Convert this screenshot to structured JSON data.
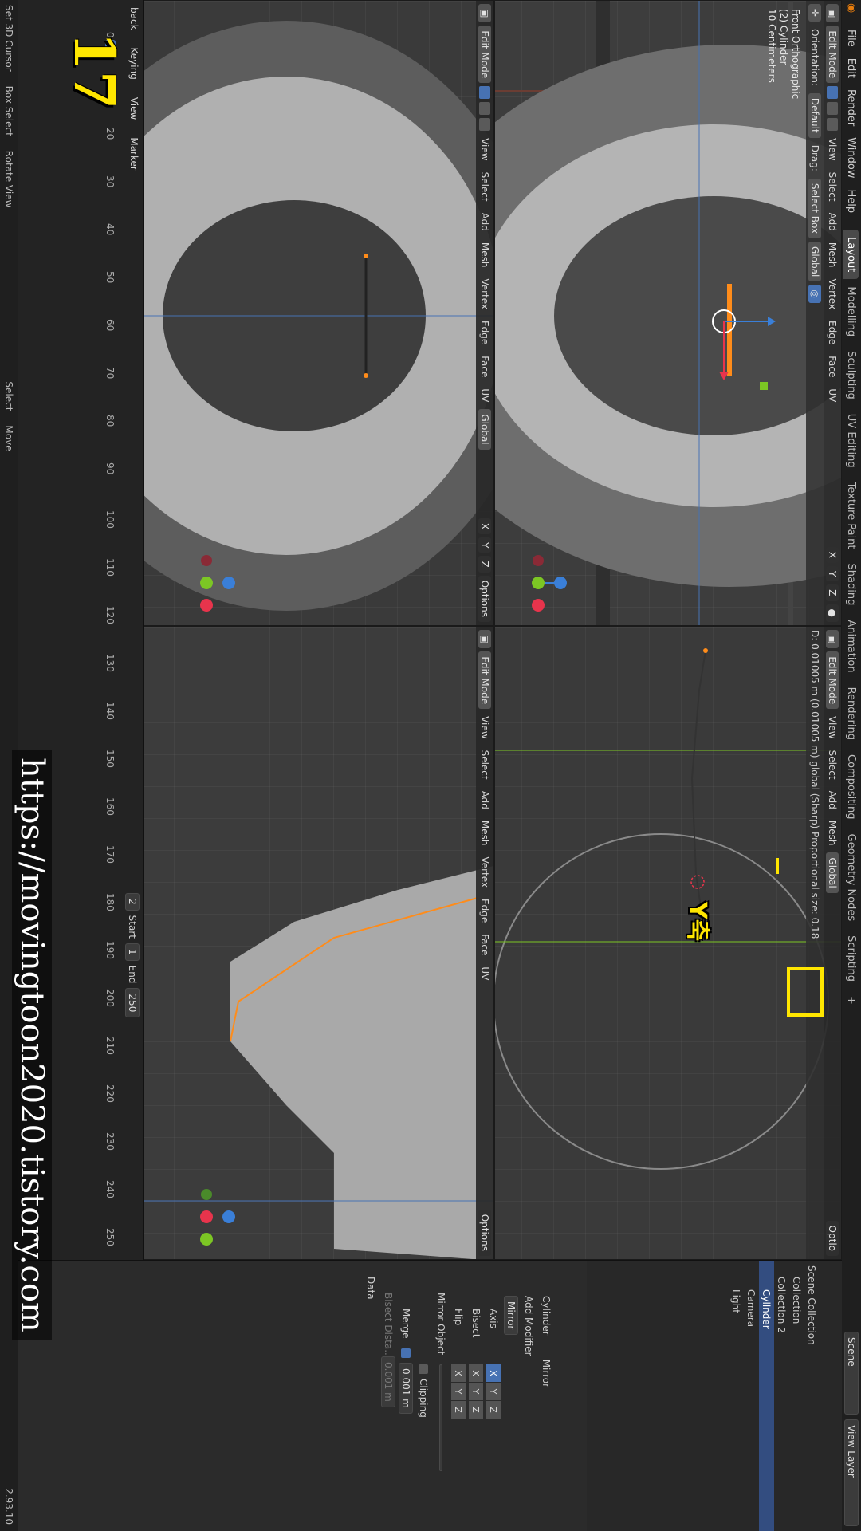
{
  "topbar": {
    "menus": [
      "File",
      "Edit",
      "Render",
      "Window",
      "Help"
    ],
    "workspaces": [
      "Layout",
      "Modelling",
      "Sculpting",
      "UV Editing",
      "Texture Paint",
      "Shading",
      "Animation",
      "Rendering",
      "Compositing",
      "Geometry Nodes",
      "Scripting"
    ],
    "active_workspace": "Layout",
    "add_tab": "+",
    "scene_label": "Scene",
    "view_layer_label": "View Layer"
  },
  "viewport_header": {
    "mode": "Edit Mode",
    "menus": [
      "View",
      "Select",
      "Add",
      "Mesh",
      "Vertex",
      "Edge",
      "Face",
      "UV"
    ],
    "transform_orientation": "Global",
    "axes": [
      "X",
      "Y",
      "Z"
    ],
    "options_label": "Options",
    "options_label_short": "Optio"
  },
  "tool_settings": {
    "orientation_label": "Orientation:",
    "orientation_value": "Default",
    "drag_label": "Drag:",
    "drag_value": "Select Box",
    "transform_orientation": "Global"
  },
  "viewport_top_left": {
    "info_line1": "Front Orthographic",
    "info_line2": "(2) Cylinder",
    "info_line3": "10 Centimeters"
  },
  "viewport_top_right": {
    "status_text": "D: 0.01005 m (0.01005 m) global (Sharp)  Proportional size: 0.18"
  },
  "timeline": {
    "menus": [
      "Playback",
      "Keying",
      "View",
      "Marker"
    ],
    "playback_short": "back",
    "current_frame": "2",
    "current_frame_field": "2",
    "ruler": [
      "0",
      "10",
      "20",
      "30",
      "40",
      "50",
      "60",
      "70",
      "80",
      "90",
      "100",
      "110",
      "120",
      "130",
      "140",
      "150",
      "160",
      "170",
      "180",
      "190",
      "200",
      "210",
      "220",
      "230",
      "240",
      "250"
    ],
    "start_label": "Start",
    "start_value": "1",
    "end_label": "End",
    "end_value": "250"
  },
  "outliner": {
    "title": "Scene Collection",
    "items": [
      "Collection",
      "Collection 2",
      "Cylinder",
      "Camera",
      "Light"
    ]
  },
  "properties": {
    "object_name": "Cylinder",
    "add_modifier": "Add Modifier",
    "modifier_name": "Mirror",
    "modifier_short": "Mirror",
    "axis_label": "Axis",
    "bisect_label": "Bisect",
    "flip_label": "Flip",
    "axis_buttons": [
      "X",
      "Y",
      "Z"
    ],
    "mirror_object_label": "Mirror Object",
    "clipping_label": "Clipping",
    "merge_label": "Merge",
    "merge_value": "0.001 m",
    "bisect_distance_label": "Bisect Dista...",
    "bisect_distance_value": "0.001 m",
    "data_label": "Data"
  },
  "statusbar": {
    "items": [
      "Set 3D Cursor",
      "Box Select",
      "Rotate View",
      "Select",
      "Move"
    ],
    "version": "2.93.10"
  },
  "annotations": {
    "step_number": "17",
    "watermark": "https://movingtoon2020.tistory.com",
    "axis_note": "Y축"
  },
  "colors": {
    "accent_blue": "#4772b3",
    "blender_orange": "#e87d0d",
    "highlight_yellow": "#ffe600",
    "axis_x": "#e8344c",
    "axis_y": "#7cc624",
    "axis_z": "#3a7fd8"
  }
}
